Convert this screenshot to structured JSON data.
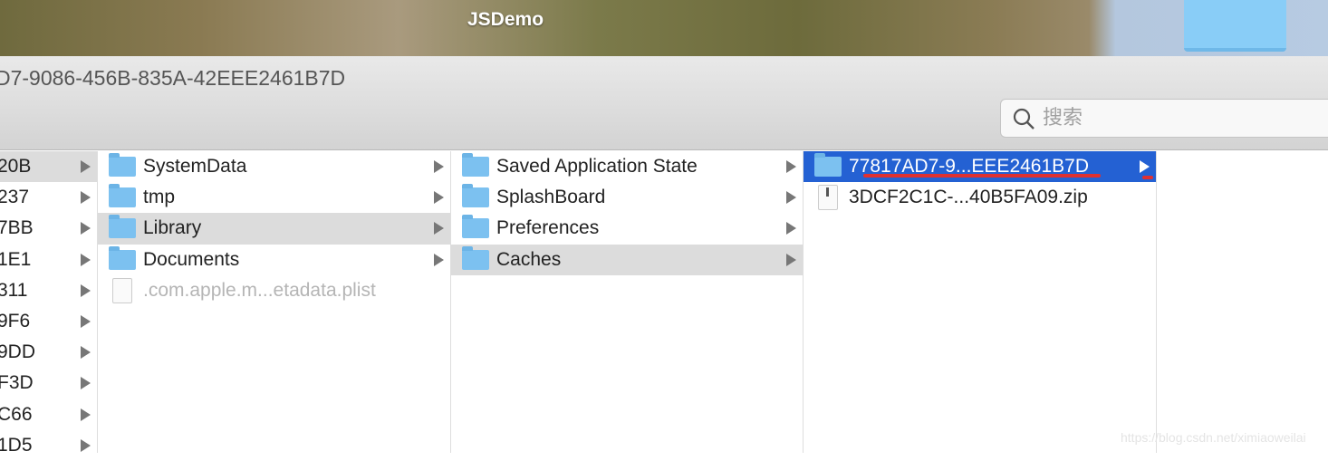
{
  "desktop": {
    "window_title": "JSDemo"
  },
  "toolbar": {
    "path": "D7-9086-456B-835A-42EEE2461B7D",
    "search_placeholder": "搜索"
  },
  "columns": [
    {
      "items": [
        {
          "label": "20B",
          "type": "folder",
          "selected": true
        },
        {
          "label": "237"
        },
        {
          "label": "7BB"
        },
        {
          "label": "1E1"
        },
        {
          "label": "311"
        },
        {
          "label": "9F6"
        },
        {
          "label": "9DD"
        },
        {
          "label": "F3D"
        },
        {
          "label": "C66"
        },
        {
          "label": "1D5"
        }
      ]
    },
    {
      "items": [
        {
          "label": "SystemData",
          "type": "folder"
        },
        {
          "label": "tmp",
          "type": "folder"
        },
        {
          "label": "Library",
          "type": "folder",
          "selected": true
        },
        {
          "label": "Documents",
          "type": "folder"
        },
        {
          "label": ".com.apple.m...etadata.plist",
          "type": "plist"
        }
      ]
    },
    {
      "items": [
        {
          "label": "Saved Application State",
          "type": "folder"
        },
        {
          "label": "SplashBoard",
          "type": "folder"
        },
        {
          "label": "Preferences",
          "type": "folder"
        },
        {
          "label": "Caches",
          "type": "folder",
          "selected": true
        }
      ]
    },
    {
      "items": [
        {
          "label": "77817AD7-9...EEE2461B7D",
          "type": "folder",
          "active": true
        },
        {
          "label": "3DCF2C1C-...40B5FA09.zip",
          "type": "zip"
        }
      ]
    }
  ],
  "watermark": "https://blog.csdn.net/ximiaoweilai",
  "colors": {
    "selection": "#2461d3",
    "annotation": "#e03030"
  }
}
